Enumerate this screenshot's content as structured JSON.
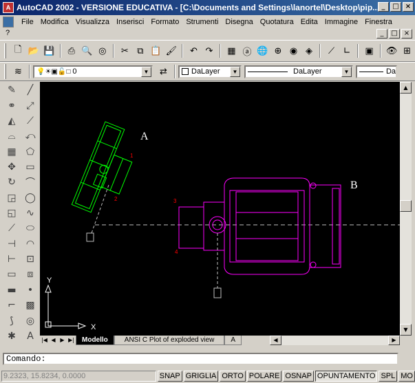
{
  "window": {
    "title": "AutoCAD 2002 - VERSIONE EDUCATIVA - [C:\\Documents and Settings\\lanortel\\Desktop\\pip...",
    "min_label": "_",
    "max_label": "□",
    "close_label": "×"
  },
  "menu": {
    "items": [
      {
        "label": "File"
      },
      {
        "label": "Modifica"
      },
      {
        "label": "Visualizza"
      },
      {
        "label": "Inserisci"
      },
      {
        "label": "Formato"
      },
      {
        "label": "Strumenti"
      },
      {
        "label": "Disegna"
      },
      {
        "label": "Quotatura"
      },
      {
        "label": "Edita"
      },
      {
        "label": "Immagine"
      },
      {
        "label": "Finestra"
      }
    ],
    "help_label": "?"
  },
  "layer_toolbar": {
    "layer_value": "0",
    "color_value": "DaLayer",
    "linetype_value": "DaLayer",
    "lineweight_value": "Da"
  },
  "drawing": {
    "label_a": "A",
    "label_b": "B",
    "markers": [
      "1",
      "2",
      "3",
      "4"
    ],
    "ucs_x": "X",
    "ucs_y": "Y",
    "colors": {
      "background": "#000000",
      "part_a": "#00ff00",
      "part_b": "#ff00ff",
      "markers": "#ff0000",
      "centerline": "#c0c0c0",
      "labels": "#ffffff"
    }
  },
  "tabs": {
    "items": [
      {
        "label": "Modello",
        "active": true
      },
      {
        "label": "ANSI C Plot of exploded view",
        "active": false
      },
      {
        "label": "A",
        "active": false
      }
    ]
  },
  "command": {
    "prompt": "Comando:"
  },
  "status": {
    "coords": "9.2323, 15.8234, 0.0000",
    "buttons": [
      {
        "label": "SNAP",
        "on": false
      },
      {
        "label": "GRIGLIA",
        "on": false
      },
      {
        "label": "ORTO",
        "on": false
      },
      {
        "label": "POLARE",
        "on": false
      },
      {
        "label": "OSNAP",
        "on": false
      },
      {
        "label": "OPUNTAMENTO",
        "on": true
      },
      {
        "label": "SPL",
        "on": false
      },
      {
        "label": "MO",
        "on": false
      }
    ]
  }
}
